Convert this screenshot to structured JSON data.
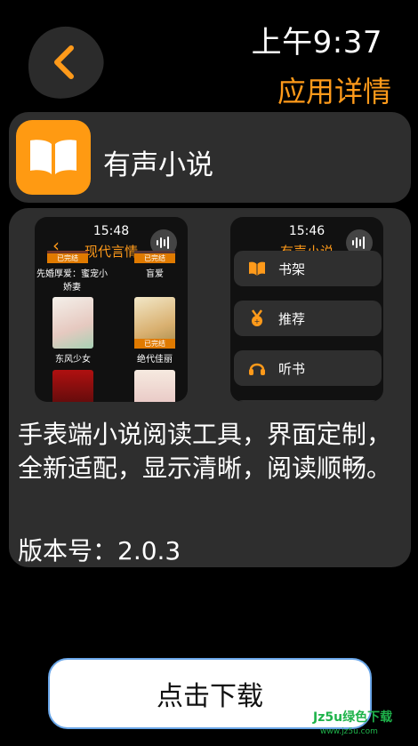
{
  "status": {
    "time": "上午9:37"
  },
  "header": {
    "title": "应用详情"
  },
  "app": {
    "name": "有声小说"
  },
  "screenshots": {
    "shot1": {
      "time": "15:48",
      "title": "现代言情",
      "books": [
        {
          "title": "先婚厚爱：蜜宠小娇妻",
          "badge": "已完结"
        },
        {
          "title": "盲爱",
          "badge": "已完结"
        },
        {
          "title": "东风少女",
          "badge": ""
        },
        {
          "title": "绝代佳丽",
          "badge": "已完结"
        },
        {
          "title": "",
          "badge": ""
        },
        {
          "title": "",
          "badge": ""
        }
      ]
    },
    "shot2": {
      "time": "15:46",
      "title": "有声小说",
      "menu": [
        {
          "label": "书架"
        },
        {
          "label": "推荐"
        },
        {
          "label": "听书"
        }
      ]
    }
  },
  "description": "手表端小说阅读工具，界面定制，全新适配，显示清晰，阅读顺畅。",
  "version": "版本号：2.0.3",
  "actions": {
    "download_label": "点击下载"
  },
  "watermark": {
    "brand": "Jz5u绿色下载",
    "url": "www.jz5u.com"
  },
  "colors": {
    "accent": "#ff9a1a",
    "card": "#2e2e2e",
    "background": "#000000"
  }
}
